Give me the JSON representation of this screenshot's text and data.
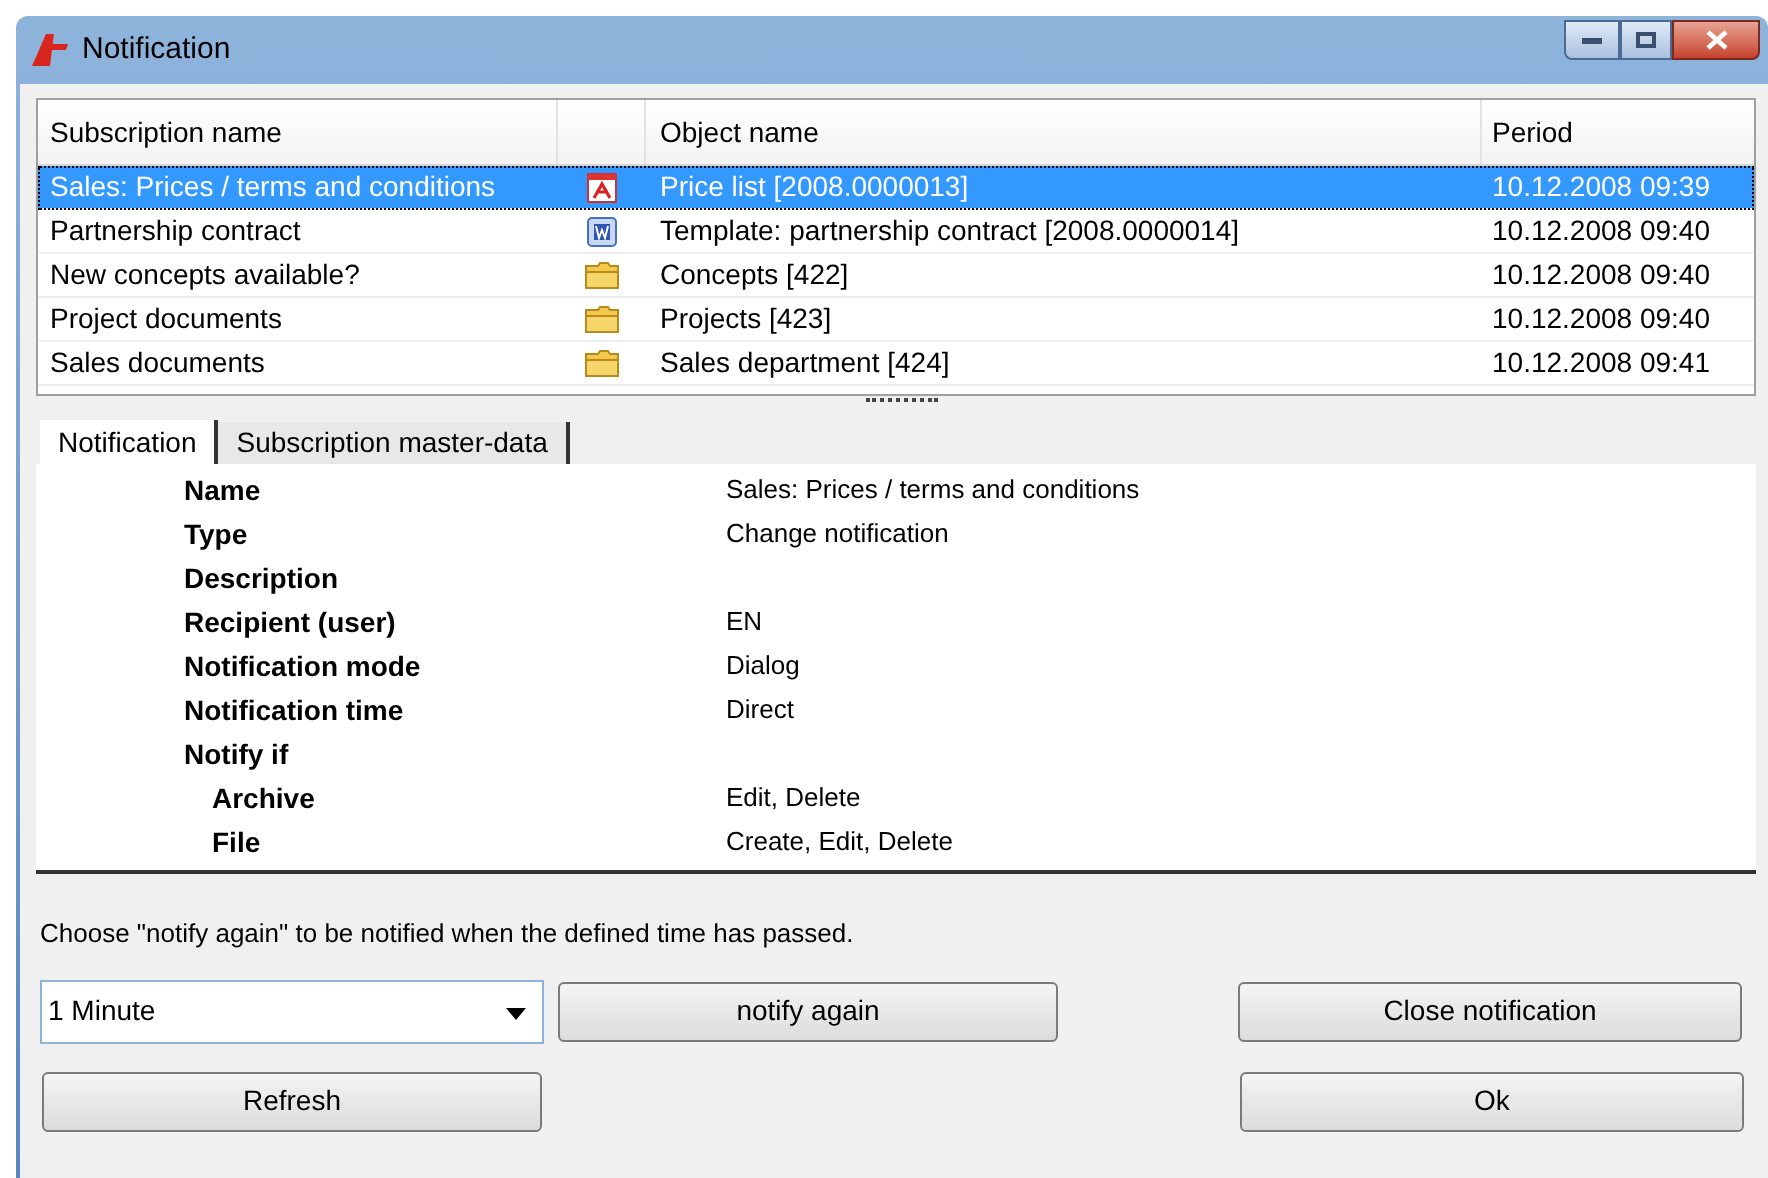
{
  "window": {
    "title": "Notification"
  },
  "table": {
    "columns": [
      "Subscription name",
      "Object name",
      "Period"
    ],
    "rows": [
      {
        "subscription": "Sales: Prices / terms and conditions",
        "kind": "pdf",
        "object": "Price list [2008.0000013]",
        "period": "10.12.2008 09:39",
        "selected": true
      },
      {
        "subscription": "Partnership contract",
        "kind": "word",
        "object": "Template: partnership contract [2008.0000014]",
        "period": "10.12.2008 09:40",
        "selected": false
      },
      {
        "subscription": "New concepts available?",
        "kind": "folder",
        "object": "Concepts [422]",
        "period": "10.12.2008 09:40",
        "selected": false
      },
      {
        "subscription": "Project documents",
        "kind": "folder",
        "object": "Projects [423]",
        "period": "10.12.2008 09:40",
        "selected": false
      },
      {
        "subscription": "Sales documents",
        "kind": "folder",
        "object": "Sales department [424]",
        "period": "10.12.2008 09:41",
        "selected": false
      }
    ]
  },
  "tabs": [
    {
      "label": "Notification",
      "selected": true
    },
    {
      "label": "Subscription master-data",
      "selected": false
    }
  ],
  "properties": [
    {
      "label": "Name",
      "value": "Sales: Prices / terms and conditions"
    },
    {
      "label": "Type",
      "value": "Change notification"
    },
    {
      "label": "Description"
    },
    {
      "label": "Recipient (user)",
      "value": "EN"
    },
    {
      "label": "Notification mode",
      "value": "Dialog"
    },
    {
      "label": "Notification time",
      "value": "Direct"
    },
    {
      "label": "Notify if",
      "children": [
        {
          "label": "Archive",
          "value": "Edit, Delete"
        },
        {
          "label": "File",
          "value": "Create, Edit, Delete"
        }
      ]
    }
  ],
  "hint": "Choose \"notify again\" to be notified when the defined time has passed.",
  "interval": {
    "value": "1 Minute"
  },
  "buttons": {
    "notify_again": "notify again",
    "close": "Close notification",
    "refresh": "Refresh",
    "ok": "Ok"
  }
}
